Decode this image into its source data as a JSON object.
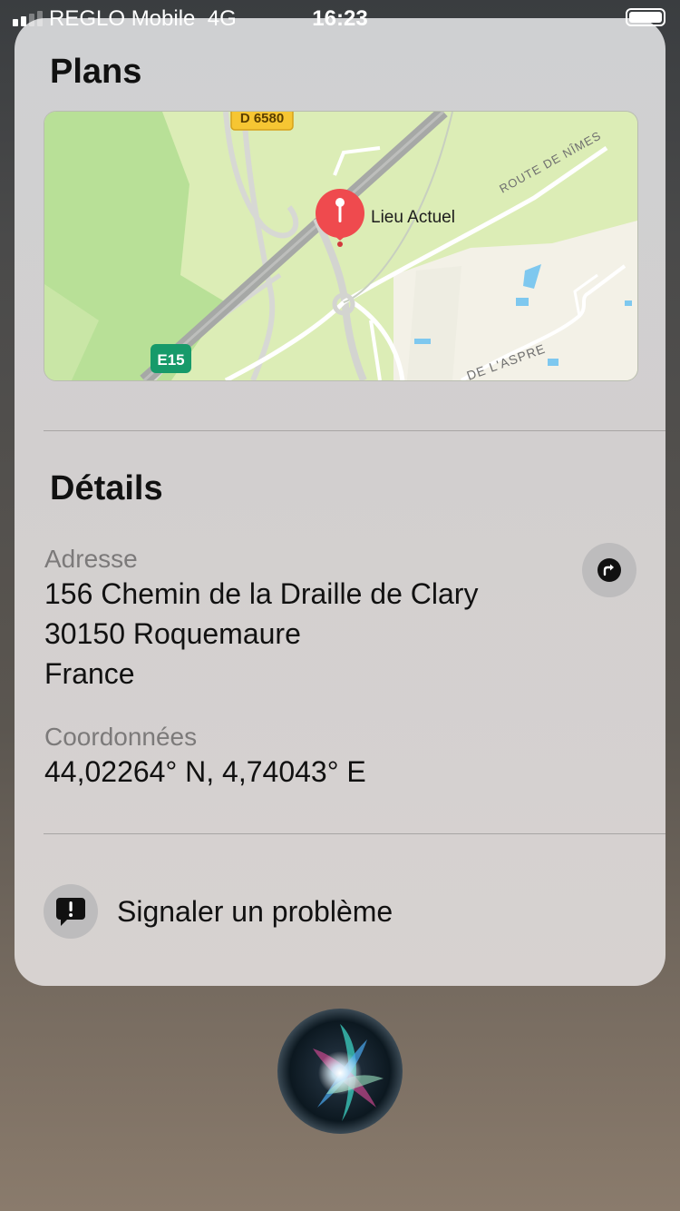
{
  "status_bar": {
    "carrier": "REGLO Mobile",
    "network": "4G",
    "time": "16:23"
  },
  "maps_section": {
    "title": "Plans",
    "pin_label": "Lieu Actuel",
    "road_labels": {
      "d_road": "D 6580",
      "european_road": "E15",
      "route_nimes": "ROUTE DE NÎMES",
      "aspre": "DE L'ASPRE"
    }
  },
  "details_section": {
    "title": "Détails",
    "address_label": "Adresse",
    "address_line1": "156 Chemin de la Draille de Clary",
    "address_line2": "30150 Roquemaure",
    "address_line3": "France",
    "coords_label": "Coordonnées",
    "coords_value": "44,02264° N, 4,74043° E"
  },
  "report": {
    "label": "Signaler un problème"
  },
  "colors": {
    "map_green": "#dcedb6",
    "map_park": "#b8e097",
    "pin_red": "#ef4a4e",
    "e_road_green": "#179a6a",
    "d_road_yellow": "#f6c633"
  }
}
